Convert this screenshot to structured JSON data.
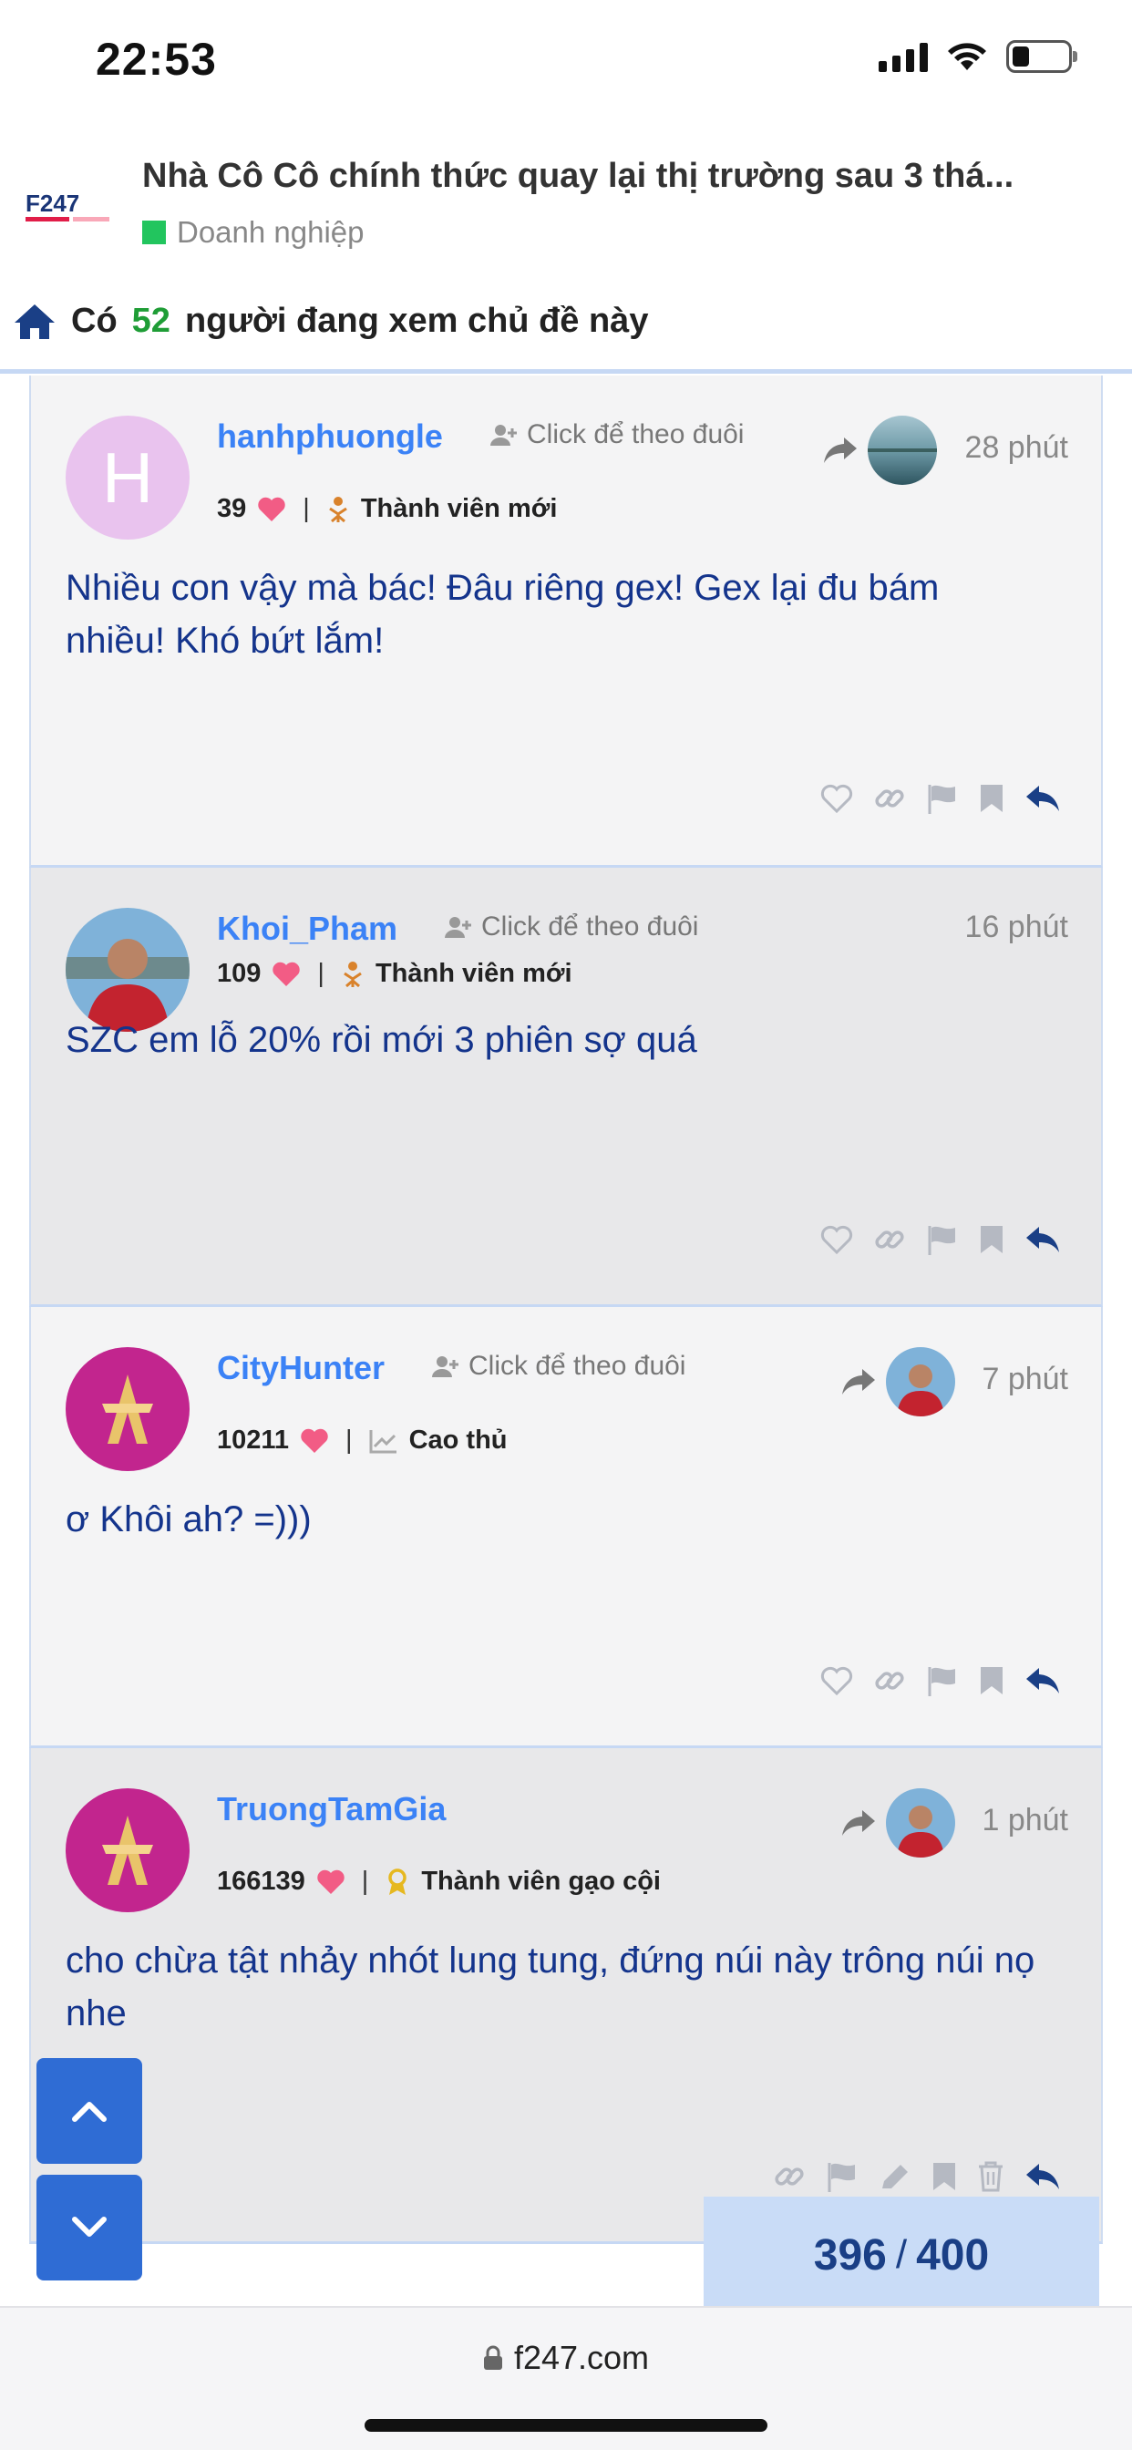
{
  "status_bar": {
    "time": "22:53"
  },
  "topic": {
    "logo_text": "F247",
    "title": "Nhà Cô Cô chính thức quay lại thị trường sau 3 thá...",
    "category": "Doanh nghiệp",
    "category_color": "#22c55e"
  },
  "viewers": {
    "prefix": "Có",
    "count": "52",
    "suffix": "người đang xem chủ đề này"
  },
  "posts": [
    {
      "username": "hanhphuongle",
      "avatar_letter": "H",
      "follow_label": "Click để theo đuôi",
      "likes": "39",
      "rank": "Thành viên mới",
      "time": "28 phút",
      "content": "Nhiều con vậy mà bác! Đâu riêng gex! Gex lại đu bám nhiều! Khó bứt lắm!"
    },
    {
      "username": "Khoi_Pham",
      "follow_label": "Click để theo đuôi",
      "likes": "109",
      "rank": "Thành viên mới",
      "time": "16 phút",
      "content": "SZC em lỗ 20% rồi mới 3 phiên sợ quá"
    },
    {
      "username": "CityHunter",
      "follow_label": "Click để theo đuôi",
      "likes": "10211",
      "rank": "Cao thủ",
      "time": "7 phút",
      "content": "ơ Khôi ah? =)))"
    },
    {
      "username": "TruongTamGia",
      "likes": "166139",
      "rank": "Thành viên gạo cội",
      "time": "1 phút",
      "content": "cho chừa tật nhảy nhót lung tung, đứng núi này trông núi nọ nhe"
    }
  ],
  "pagination": {
    "current": "396",
    "separator": "/",
    "total": "400"
  },
  "browser": {
    "url": "f247.com"
  },
  "colors": {
    "link_blue": "#3b82f6",
    "content_blue": "#14348c",
    "nav_button": "#2f6cd4",
    "heart": "#f25c85"
  }
}
